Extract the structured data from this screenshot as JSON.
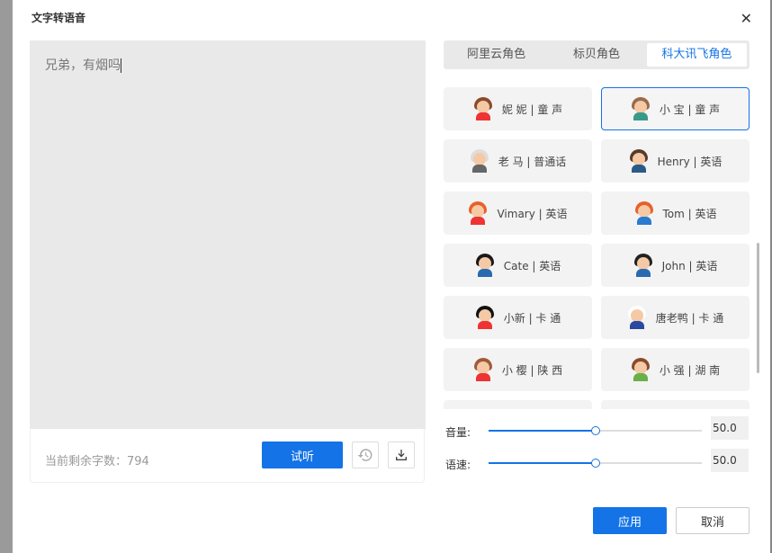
{
  "dialog": {
    "title": "文字转语音",
    "close_icon": "close-icon"
  },
  "editor": {
    "text": "兄弟，有烟吗"
  },
  "footer": {
    "remaining": "当前剩余字数：794",
    "listen": "试听",
    "history_icon": "history-icon",
    "download_icon": "download-icon"
  },
  "tabs": [
    {
      "label": "阿里云角色"
    },
    {
      "label": "标贝角色"
    },
    {
      "label": "科大讯飞角色",
      "active": true
    }
  ],
  "voices": [
    {
      "label": "妮 妮 | 童 声",
      "hair": "#8b4a2a",
      "body": "#e33"
    },
    {
      "label": "小 宝 | 童 声",
      "hair": "#9a6a4a",
      "body": "#3a9a8a",
      "selected": true
    },
    {
      "label": "老 马 | 普通话",
      "hair": "#ddd",
      "body": "#666"
    },
    {
      "label": "Henry | 英语",
      "hair": "#5a3a2a",
      "body": "#2a5a8a"
    },
    {
      "label": "Vimary | 英语",
      "hair": "#e8602a",
      "body": "#e33"
    },
    {
      "label": "Tom | 英语",
      "hair": "#e8602a",
      "body": "#2a7ad0"
    },
    {
      "label": "Cate | 英语",
      "hair": "#1a1a1a",
      "body": "#2a6ab0"
    },
    {
      "label": "John | 英语",
      "hair": "#222",
      "body": "#2a6ab0"
    },
    {
      "label": "小新 | 卡 通",
      "hair": "#111",
      "body": "#e33"
    },
    {
      "label": "唐老鸭 | 卡 通",
      "hair": "#fff",
      "body": "#2a4aa0"
    },
    {
      "label": "小 樱 | 陕 西",
      "hair": "#a05a3a",
      "body": "#e33"
    },
    {
      "label": "小 强 | 湖 南",
      "hair": "#8a4a2a",
      "body": "#6ab04a"
    },
    {
      "label": "",
      "hair": "#666",
      "body": "#888"
    },
    {
      "label": "",
      "hair": "#666",
      "body": "#888"
    }
  ],
  "volume": {
    "label": "音量:",
    "value": "50.0",
    "percent": 50
  },
  "speed": {
    "label": "语速:",
    "value": "50.0",
    "percent": 50
  },
  "buttons": {
    "apply": "应用",
    "cancel": "取消"
  },
  "colors": {
    "accent": "#1473e6"
  }
}
